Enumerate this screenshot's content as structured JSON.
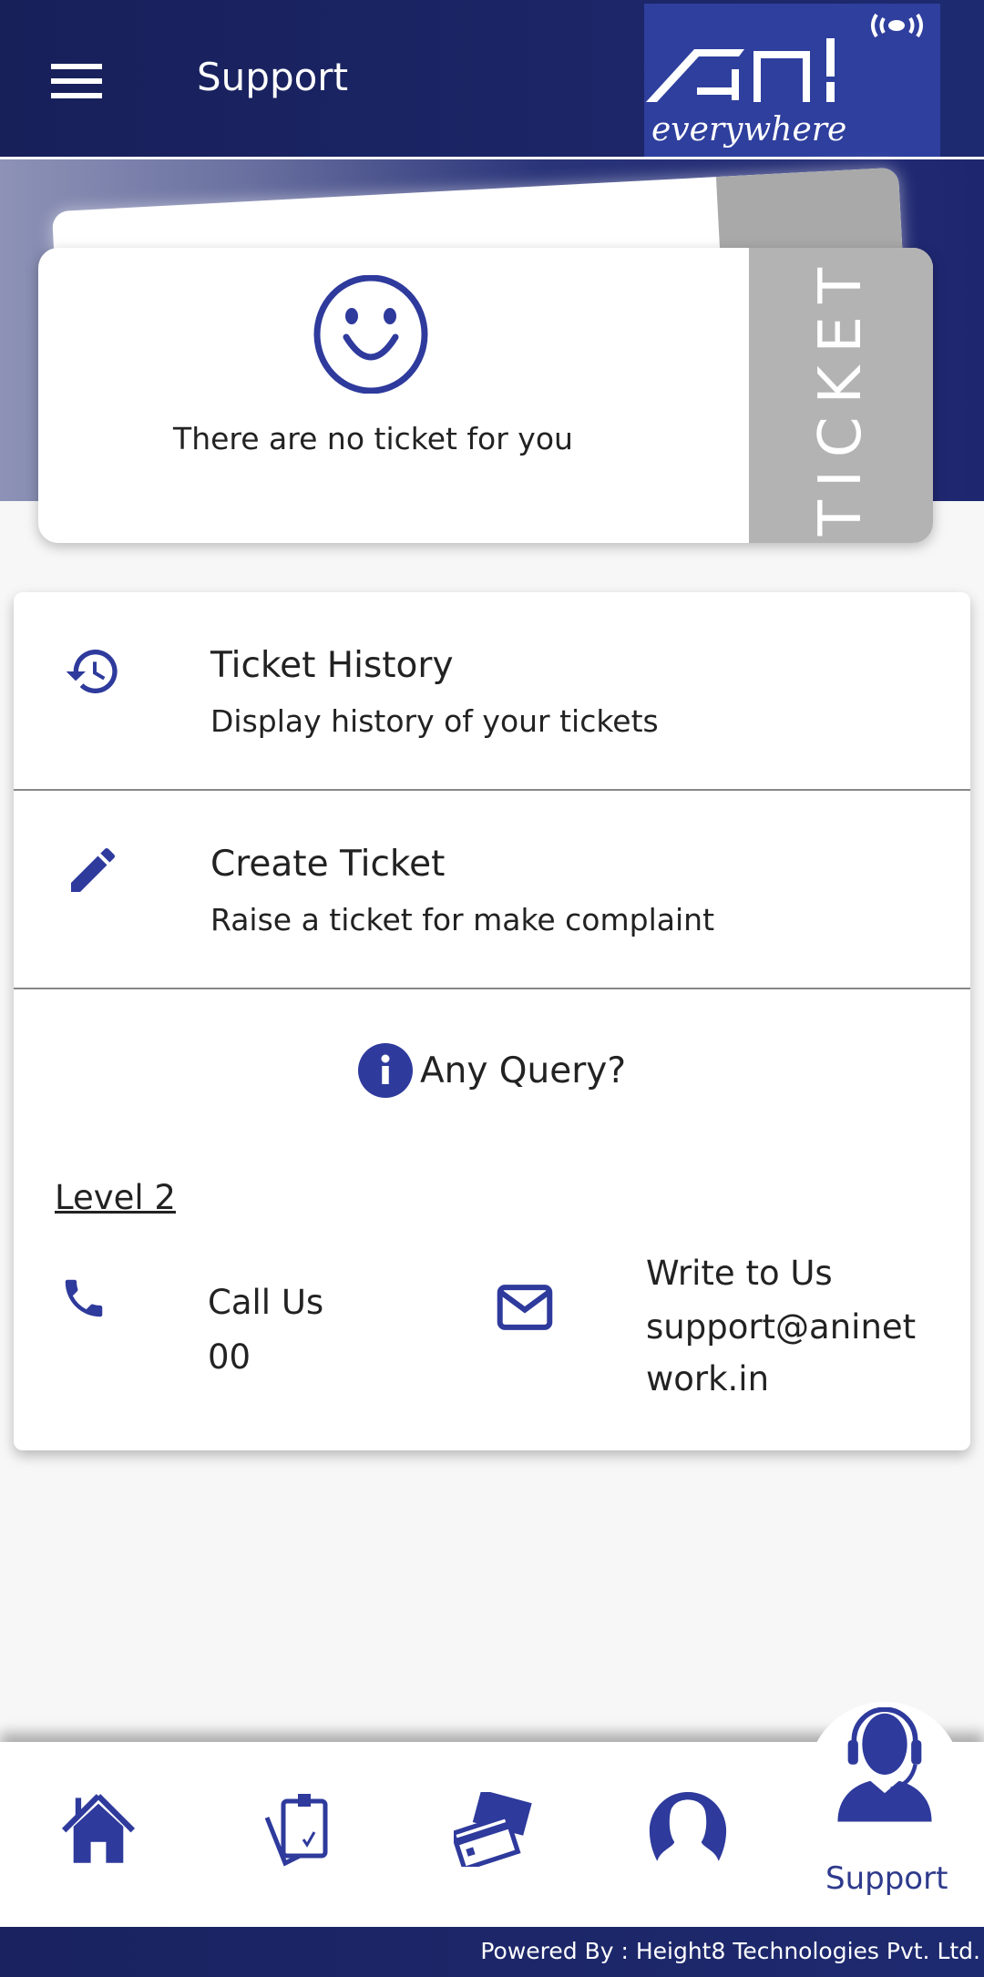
{
  "header": {
    "title": "Support",
    "logo_text": "ANI",
    "logo_tagline": "everywhere"
  },
  "colors": {
    "primary": "#2e3a9c",
    "header": "#1c2566",
    "stub": "#b3b3b3"
  },
  "ticket": {
    "stub_label": "TICKET",
    "empty_message": "There are no ticket for you",
    "icon": "smiley-icon"
  },
  "menu": [
    {
      "title": "Ticket History",
      "subtitle": "Display history of your tickets",
      "icon": "history-icon"
    },
    {
      "title": "Create Ticket",
      "subtitle": "Raise a ticket for make complaint",
      "icon": "pencil-icon"
    }
  ],
  "query": {
    "title": "Any Query?",
    "level": "Level 2",
    "call_label": "Call Us",
    "call_value": "00",
    "write_label": "Write to Us",
    "email_line1": "support@aninet",
    "email_line2": "work.in"
  },
  "bottom_nav": {
    "items": [
      "home-icon",
      "plans-icon",
      "payments-icon",
      "profile-icon",
      "support-icon"
    ],
    "active_label": "Support"
  },
  "footer": {
    "text": "Powered By : Height8 Technologies Pvt. Ltd."
  }
}
